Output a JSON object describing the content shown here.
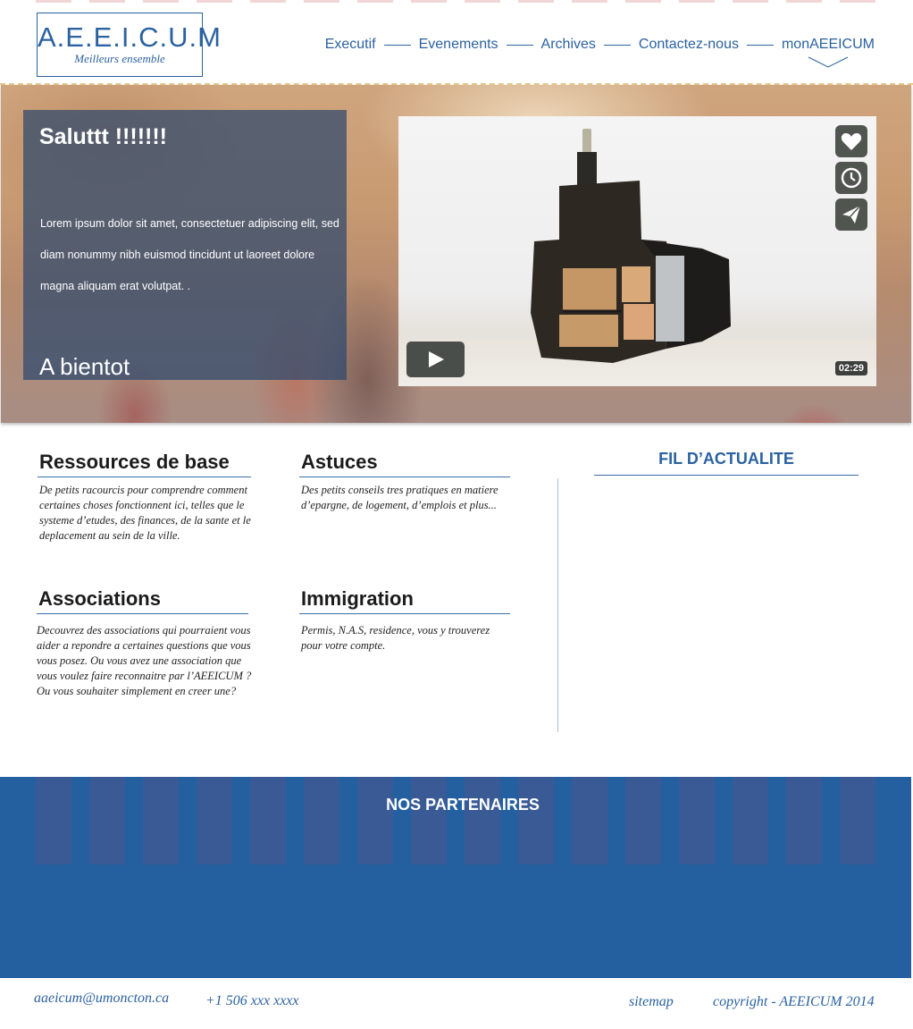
{
  "header": {
    "logo_title": "A.E.E.I.C.U.M",
    "logo_tagline": "Meilleurs ensemble",
    "nav": [
      {
        "label": "Executif"
      },
      {
        "label": "Evenements"
      },
      {
        "label": "Archives"
      },
      {
        "label": "Contactez-nous"
      },
      {
        "label": "monAEEICUM"
      }
    ]
  },
  "hero": {
    "title": "Saluttt !!!!!!!",
    "text": "Lorem ipsum dolor sit amet, consectetuer adipiscing elit, sed diam nonummy nibh euismod tincidunt ut laoreet dolore magna aliquam erat volutpat. .",
    "signoff": "A bientot",
    "video": {
      "duration": "02:29",
      "controls": [
        "heart-icon",
        "clock-icon",
        "send-icon"
      ],
      "play_icon": "play-icon"
    }
  },
  "sections": [
    {
      "title": "Ressources de base",
      "description": "De petits racourcis pour comprendre comment certaines choses fonctionnent ici, telles que le systeme d’etudes, des finances, de la sante et le deplacement au sein de la ville."
    },
    {
      "title": "Astuces",
      "description": "Des petits conseils tres pratiques en matiere d’epargne, de logement, d’emplois et plus..."
    },
    {
      "title": "Associations",
      "description": "Decouvrez des associations qui pourraient vous aider a repondre a certaines questions que vous vous posez. Ou vous avez une association que vous voulez faire reconnaitre par l’AEEICUM ? Ou vous souhaiter simplement en creer une?"
    },
    {
      "title": "Immigration",
      "description": "Permis, N.A.S, residence, vous y trouverez pour votre compte."
    }
  ],
  "news": {
    "title": "FIL D’ACTUALITE"
  },
  "partners": {
    "title": "NOS PARTENAIRES"
  },
  "footer": {
    "email": "aaeicum@umoncton.ca",
    "phone": "+1 506 xxx xxxx",
    "sitemap": "sitemap",
    "copyright": "copyright - AEEICUM 2014"
  },
  "colors": {
    "brand_blue": "#2b62a0",
    "partners_bg": "#2460a0",
    "hero_panel": "#2c486e"
  }
}
